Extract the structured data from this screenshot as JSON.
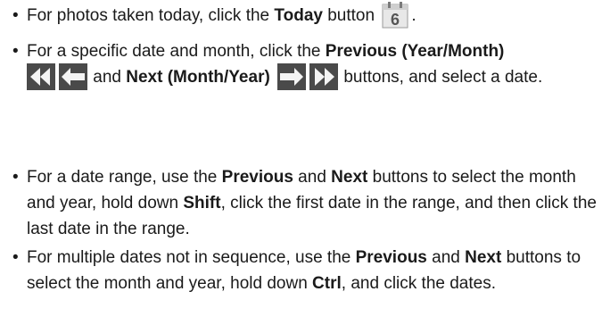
{
  "bullet": "•",
  "items": [
    {
      "t1": "For photos taken today, click the ",
      "b1": "Today",
      "t2": " button",
      "t3": "."
    },
    {
      "t1": "For a specific date and month, click the ",
      "b1": "Previous (Year/Month)",
      "t2": " and ",
      "b2": "Next (Month/Year)",
      "t3": " buttons, and select a date."
    },
    {
      "t1": "For a date range, use the ",
      "b1": "Previous",
      "t2": " and ",
      "b2": "Next",
      "t3": " buttons to select the month and year, hold down ",
      "b3": "Shift",
      "t4": ", click the first date in the range, and then click the last date in the range."
    },
    {
      "t1": "For multiple dates not in sequence, use the ",
      "b1": "Previous",
      "t2": " and ",
      "b2": "Next",
      "t3": " buttons to select the month and year, hold down ",
      "b3": "Ctrl",
      "t4": ", and click the dates."
    }
  ],
  "icons": {
    "today": "calendar-today-icon",
    "prev_year": "double-left-arrow-icon",
    "prev_month": "left-arrow-icon",
    "next_month": "right-arrow-icon",
    "next_year": "double-right-arrow-icon",
    "accent": "#2a7fd4"
  },
  "today_icon_text": "6"
}
